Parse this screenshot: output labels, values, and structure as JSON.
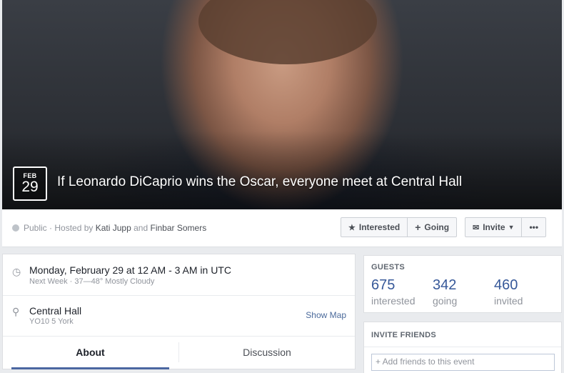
{
  "event": {
    "date_month": "FEB",
    "date_day": "29",
    "title": "If Leonardo DiCaprio wins the Oscar, everyone meet at Central Hall"
  },
  "meta": {
    "privacy": "Public",
    "hosted_prefix": "· Hosted by",
    "host1": "Kati Jupp",
    "and": "and",
    "host2": "Finbar Somers"
  },
  "actions": {
    "interested": "Interested",
    "going": "Going",
    "invite": "Invite",
    "more": "•••"
  },
  "details": {
    "datetime": "Monday, February 29 at 12 AM - 3 AM in UTC",
    "weather": "Next Week · 37—48° Mostly Cloudy",
    "location_name": "Central Hall",
    "location_address": "YO10 5 York",
    "show_map": "Show Map"
  },
  "tabs": {
    "about": "About",
    "discussion": "Discussion"
  },
  "guests": {
    "title": "GUESTS",
    "stats": [
      {
        "count": "675",
        "label": "interested"
      },
      {
        "count": "342",
        "label": "going"
      },
      {
        "count": "460",
        "label": "invited"
      }
    ]
  },
  "invite_friends": {
    "title": "INVITE FRIENDS",
    "placeholder": "+ Add friends to this event"
  },
  "icons": {
    "clock": "clock-icon",
    "pin": "location-pin-icon",
    "star": "star-icon",
    "plus": "plus-icon",
    "envelope": "envelope-icon",
    "caret": "caret-down-icon",
    "globe": "globe-icon"
  }
}
